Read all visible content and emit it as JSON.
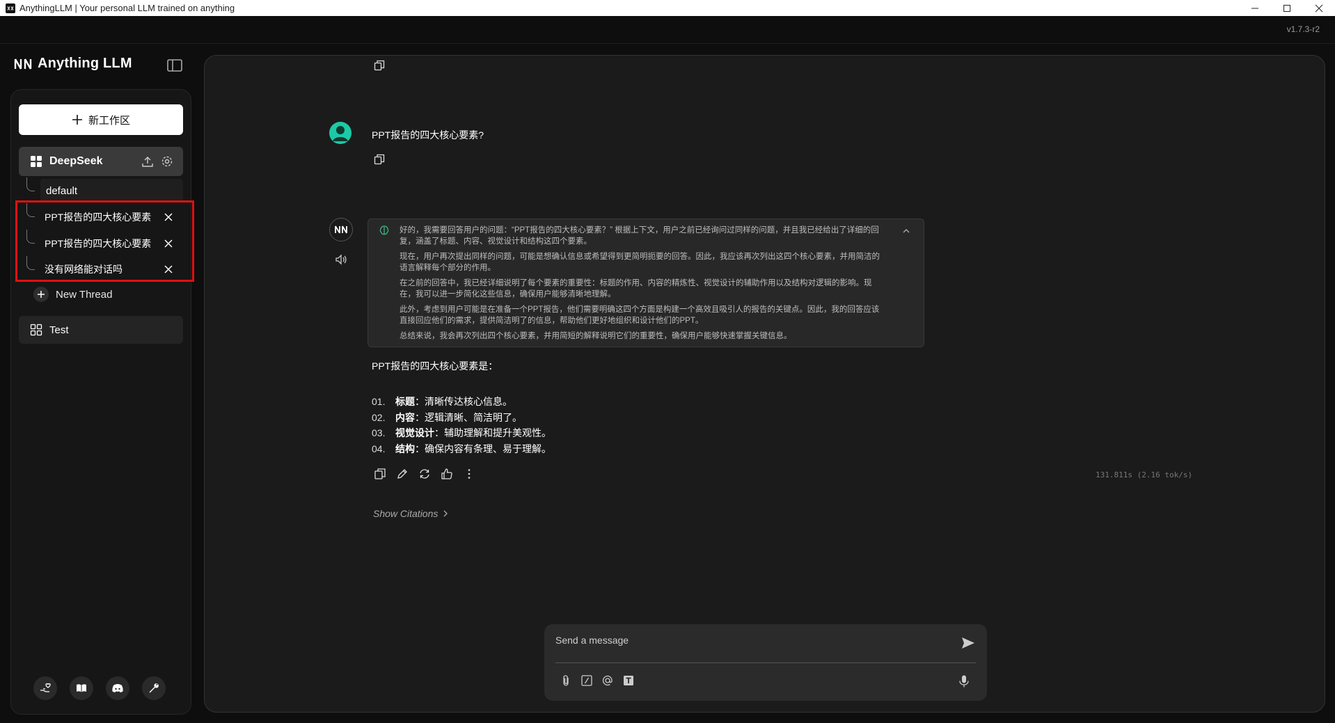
{
  "window": {
    "title": "AnythingLLM | Your personal LLM trained on anything"
  },
  "app": {
    "version": "v1.7.3-r2",
    "brand": "Anything LLM"
  },
  "sidebar": {
    "new_workspace_label": "新工作区",
    "workspaces": [
      {
        "name": "DeepSeek",
        "threads": [
          {
            "label": "default"
          },
          {
            "label": "PPT报告的四大核心要素"
          },
          {
            "label": "PPT报告的四大核心要素"
          },
          {
            "label": "没有网络能对话吗"
          }
        ],
        "new_thread_label": "New Thread"
      },
      {
        "name": "Test"
      }
    ]
  },
  "chat": {
    "user_message": "PPT报告的四大核心要素?",
    "thinking": [
      "好的，我需要回答用户的问题：“PPT报告的四大核心要素？” 根据上下文，用户之前已经询问过同样的问题，并且我已经给出了详细的回复，涵盖了标题、内容、视觉设计和结构这四个要素。",
      "现在，用户再次提出同样的问题，可能是想确认信息或希望得到更简明扼要的回答。因此，我应该再次列出这四个核心要素，并用简洁的语言解释每个部分的作用。",
      "在之前的回答中，我已经详细说明了每个要素的重要性：标题的作用、内容的精炼性、视觉设计的辅助作用以及结构对逻辑的影响。现在，我可以进一步简化这些信息，确保用户能够清晰地理解。",
      "此外，考虑到用户可能是在准备一个PPT报告，他们需要明确这四个方面是构建一个高效且吸引人的报告的关键点。因此，我的回答应该直接回应他们的需求，提供简洁明了的信息，帮助他们更好地组织和设计他们的PPT。",
      "总结来说，我会再次列出四个核心要素，并用简短的解释说明它们的重要性，确保用户能够快速掌握关键信息。"
    ],
    "answer_intro": "PPT报告的四大核心要素是：",
    "answer_items": [
      {
        "num": "01.",
        "term": "标题",
        "desc": "：清晰传达核心信息。"
      },
      {
        "num": "02.",
        "term": "内容",
        "desc": "：逻辑清晰、简洁明了。"
      },
      {
        "num": "03.",
        "term": "视觉设计",
        "desc": "：辅助理解和提升美观性。"
      },
      {
        "num": "04.",
        "term": "结构",
        "desc": "：确保内容有条理、易于理解。"
      }
    ],
    "stats": "131.811s (2.16 tok/s)",
    "citations_label": "Show Citations"
  },
  "prompt": {
    "placeholder": "Send a message"
  }
}
